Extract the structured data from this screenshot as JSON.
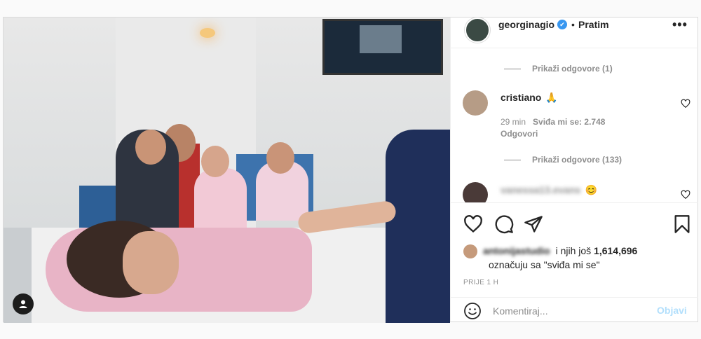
{
  "header": {
    "username": "georginagio",
    "verified_mark": "✔",
    "separator": "•",
    "follow_label": "Pratim",
    "more_label": "•••"
  },
  "comments": {
    "show_replies_1": "Prikaži odgovore (1)",
    "main_comment": {
      "username": "cristiano",
      "emoji": "🙏",
      "time": "29 min",
      "likes": "Sviđa mi se: 2.748",
      "reply_label": "Odgovori"
    },
    "show_replies_2": "Prikaži odgovore (133)",
    "next_comment": {
      "username": "vanessa13.evans",
      "emoji": "😊"
    }
  },
  "likes": {
    "liker_name": "antonijastudio",
    "text_mid": "i njih još",
    "count": "1,614,696",
    "line2": "označuju sa \"sviđa mi se\""
  },
  "post_date": "PRIJE 1 H",
  "comment_box": {
    "placeholder": "Komentiraj...",
    "post_label": "Objavi"
  },
  "icons": {
    "like": "heart-icon",
    "comment": "comment-icon",
    "share": "share-icon",
    "save": "bookmark-icon",
    "emoji": "emoji-icon",
    "tag": "user-tag-icon"
  },
  "colors": {
    "verified": "#3897f0",
    "secondary_text": "#8e8e8e",
    "post_button_disabled": "#b2dffc"
  }
}
